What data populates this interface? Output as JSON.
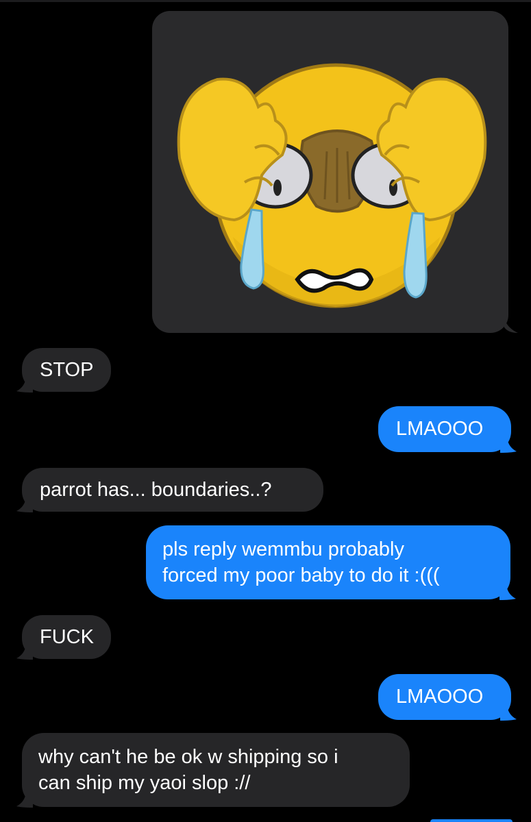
{
  "conversation": {
    "image_message": {
      "icon": "crying-covering-eyes-emoji-icon"
    },
    "messages": [
      {
        "sender": "them",
        "text": "STOP"
      },
      {
        "sender": "me",
        "text": "LMAOOO"
      },
      {
        "sender": "them",
        "text": "parrot has... boundaries..?"
      },
      {
        "sender": "me",
        "lines": [
          "pls reply wemmbu probably",
          "forced my poor baby to do it :((("
        ]
      },
      {
        "sender": "them",
        "text": "FUCK"
      },
      {
        "sender": "me",
        "text": "LMAOOO"
      },
      {
        "sender": "them",
        "lines": [
          "why can't he be ok w shipping so i",
          "can ship my yaoi slop ://"
        ]
      }
    ]
  },
  "colors": {
    "background": "#000000",
    "incoming_bubble": "#262628",
    "outgoing_bubble": "#1a84fb",
    "text": "#ffffff"
  }
}
